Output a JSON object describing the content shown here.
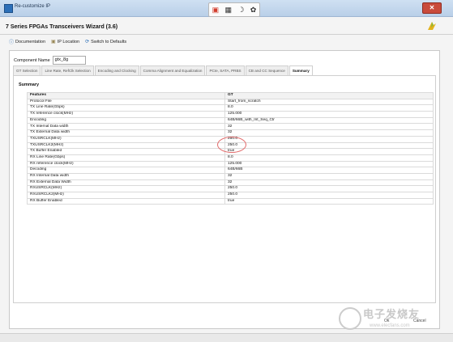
{
  "window": {
    "title": "Re-customize IP"
  },
  "wizard": {
    "title": "7 Series FPGAs Transceivers Wizard (3.6)"
  },
  "toolbar": {
    "documentation": "Documentation",
    "ip_location": "IP Location",
    "switch_defaults": "Switch to Defaults"
  },
  "component": {
    "label": "Component Name",
    "value": "gtx_8g"
  },
  "tabs": [
    {
      "label": "GT Selection"
    },
    {
      "label": "Line Rate, RefClk Selection"
    },
    {
      "label": "Encoding and Clocking"
    },
    {
      "label": "Comma Alignment and Equalization"
    },
    {
      "label": "PCIe, SATA, PRBS"
    },
    {
      "label": "CB and CC Sequence"
    },
    {
      "label": "Summary"
    }
  ],
  "summary": {
    "heading": "Summary",
    "header": {
      "key": "Features",
      "value": "GT"
    },
    "rows": [
      {
        "key": "Protocol File",
        "value": "Start_from_scratch"
      },
      {
        "key": "TX Line Rate(Gbps)",
        "value": "8.0"
      },
      {
        "key": "TX reference clock(MHz)",
        "value": "125.000"
      },
      {
        "key": "Encoding",
        "value": "64B/66B_with_Int_Seq_Ctr"
      },
      {
        "key": "TX Internal Data width",
        "value": "32"
      },
      {
        "key": "TX External Data width",
        "value": "32"
      },
      {
        "key": "TXUSRCLK(MHz)",
        "value": "250.0"
      },
      {
        "key": "TXUSRCLK2(MHz)",
        "value": "250.0"
      },
      {
        "key": "TX Buffer Enabled",
        "value": "true"
      },
      {
        "key": "RX Line Rate(Gbps)",
        "value": "8.0"
      },
      {
        "key": "RX reference clock(MHz)",
        "value": "125.000"
      },
      {
        "key": "Decoding",
        "value": "64B/66B"
      },
      {
        "key": "RX Internal Data width",
        "value": "32"
      },
      {
        "key": "RX External Data Width",
        "value": "32"
      },
      {
        "key": "RXUSRCLK(MHz)",
        "value": "250.0"
      },
      {
        "key": "RXUSRCLK2(MHz)",
        "value": "250.0"
      },
      {
        "key": "RX Buffer Enabled",
        "value": "true"
      }
    ]
  },
  "buttons": {
    "ok": "Ok",
    "cancel": "Cancel"
  },
  "watermark": {
    "text": "电子发烧友",
    "url": "www.elecfans.com"
  },
  "colors": {
    "titlebar": "#cfe0f2",
    "close": "#c94b3b",
    "highlight": "#e26a6a"
  },
  "icons": {
    "info": "info-icon",
    "folder": "folder-icon",
    "refresh": "refresh-icon",
    "logo": "vivado-logo-icon",
    "close": "close-icon"
  }
}
